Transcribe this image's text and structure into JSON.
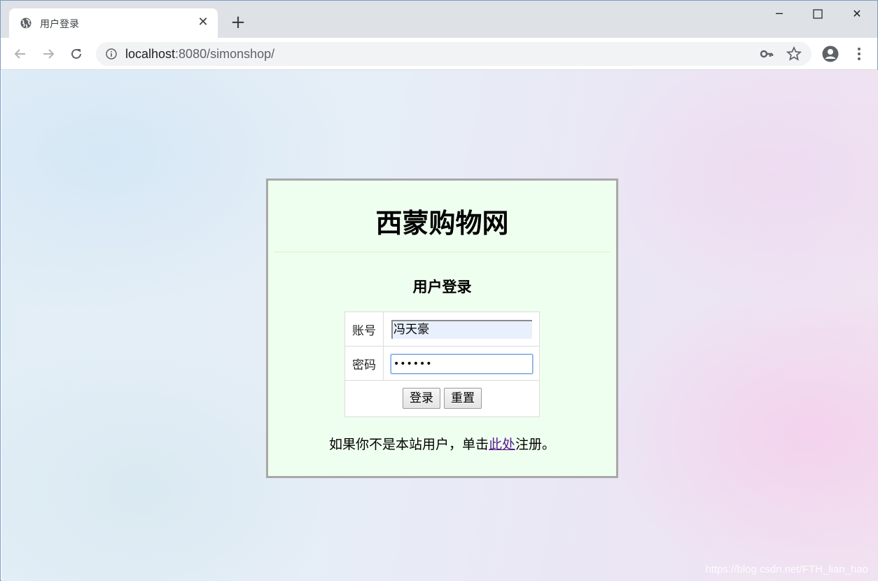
{
  "browser": {
    "tab_title": "用户登录",
    "url_host": "localhost",
    "url_path": ":8080/simonshop/"
  },
  "page": {
    "site_title": "西蒙购物网",
    "subtitle": "用户登录",
    "form": {
      "username_label": "账号",
      "username_value": "冯天豪",
      "password_label": "密码",
      "password_value": "••••••",
      "login_button": "登录",
      "reset_button": "重置"
    },
    "register": {
      "prefix": "如果你不是本站用户，单击",
      "link_text": "此处",
      "suffix": "注册。"
    },
    "watermark": "https://blog.csdn.net/FTH_lian_hao"
  },
  "colors": {
    "login_box_bg": "#efffef",
    "login_box_border": "#a8a8a8",
    "link_visited": "#551a8b"
  },
  "icons": [
    "globe-icon",
    "close-icon",
    "plus-icon",
    "minimize-icon",
    "maximize-icon",
    "window-close-icon",
    "back-icon",
    "forward-icon",
    "reload-icon",
    "info-icon",
    "key-icon",
    "star-icon",
    "profile-icon",
    "menu-icon"
  ]
}
